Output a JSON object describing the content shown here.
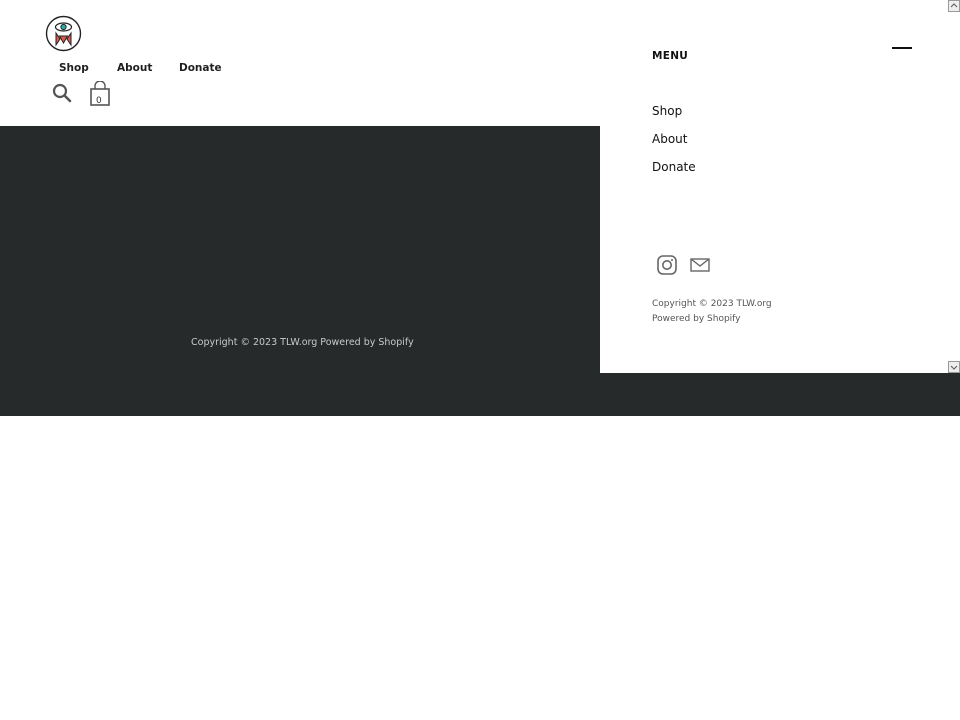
{
  "header": {
    "logo_alt": "TLW logo",
    "nav": [
      "Shop",
      "About",
      "Donate"
    ],
    "cart_count": "0"
  },
  "footer": {
    "copyright": "Copyright © 2023 TLW.org Powered by Shopify"
  },
  "drawer": {
    "title": "MENU",
    "links": [
      "Shop",
      "About",
      "Donate"
    ],
    "copyright_line1": "Copyright © 2023 TLW.org",
    "copyright_line2": "Powered by Shopify"
  },
  "colors": {
    "dark_band": "#262a2b",
    "drawer_bg": "#ffffff",
    "logo_red": "#e2574c",
    "logo_teal": "#28b0b0"
  },
  "icons": {
    "search": "search-icon",
    "cart": "shopping-bag-icon",
    "instagram": "instagram-icon",
    "email": "mail-icon",
    "close": "close-line-icon"
  }
}
